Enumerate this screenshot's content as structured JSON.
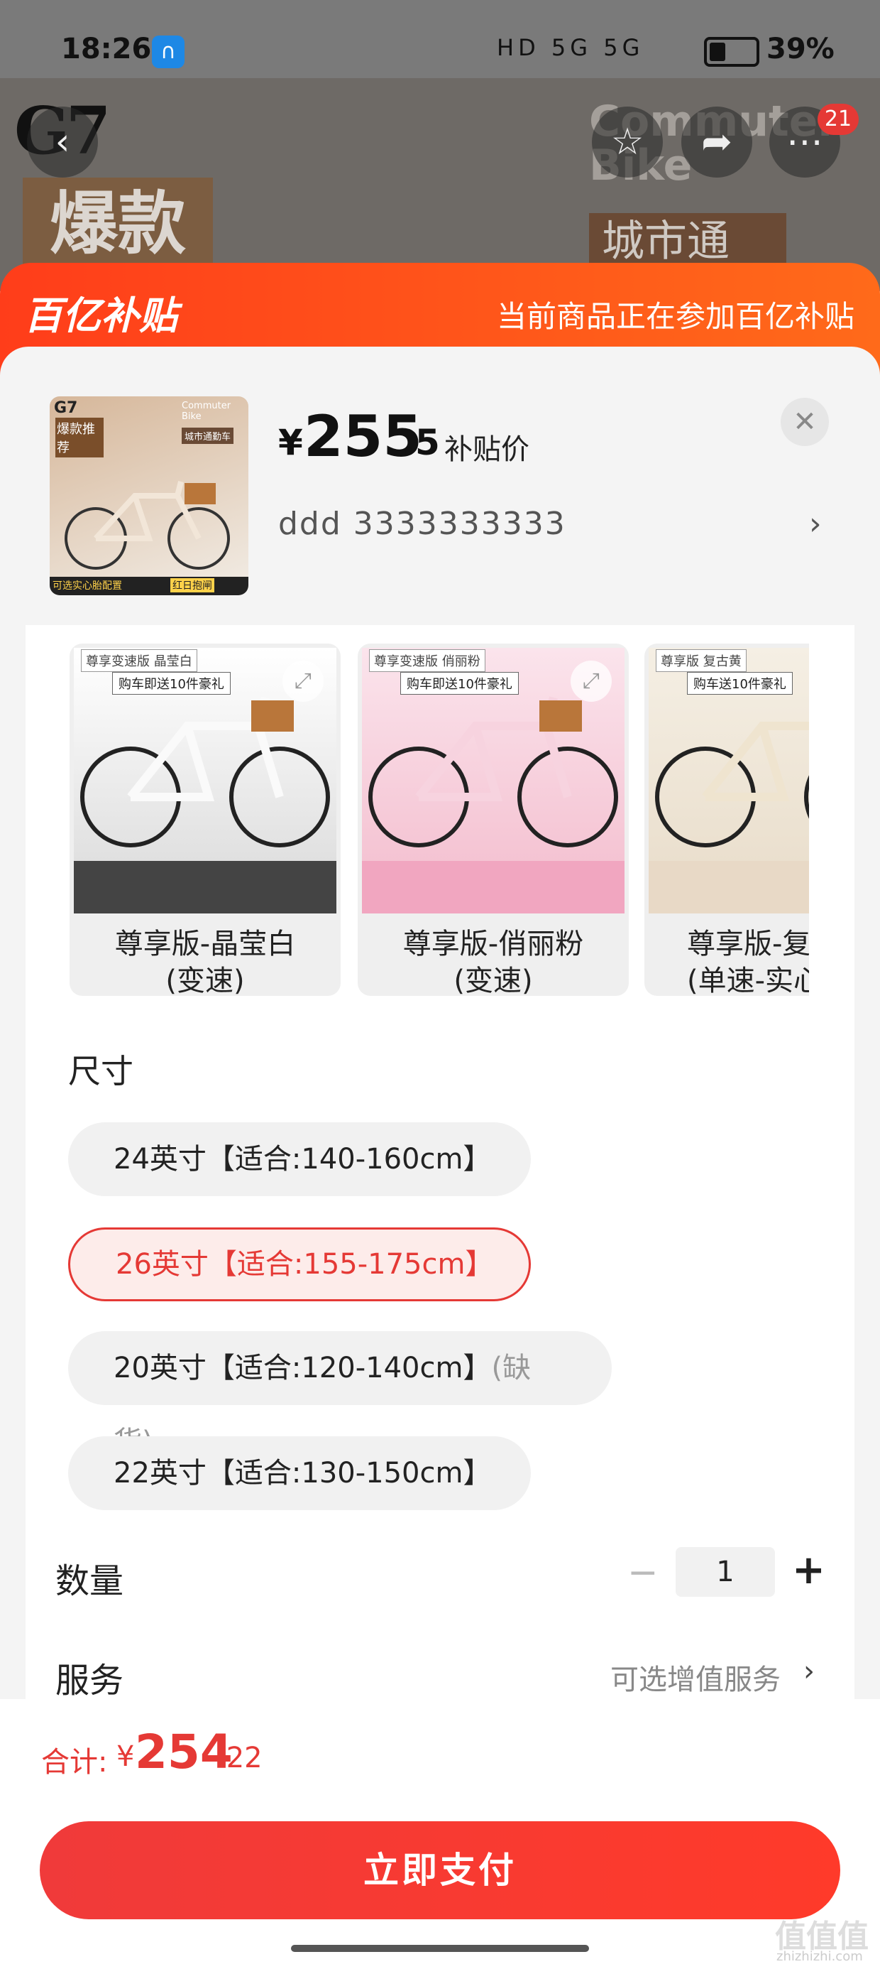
{
  "status_bar": {
    "time": "18:26",
    "battery": "39%",
    "headphones_icon": "headphones-icon",
    "signal_text": "HD 5G 5G"
  },
  "hero": {
    "brand": "G7",
    "hot_label": "爆款",
    "en_title": "Commuter Bike",
    "city_label": "城市通",
    "cart_badge": "21",
    "icons": [
      "back-arrow-icon",
      "star-icon",
      "share-icon",
      "more-icon"
    ]
  },
  "banner": {
    "logo": "百亿补贴",
    "message": "当前商品正在参加百亿补贴"
  },
  "product": {
    "price_symbol": "¥",
    "price_int": "255",
    "price_dec": ".5",
    "price_label": "补贴价",
    "sku_text": "ddd  3333333333",
    "thumb": {
      "brand": "G7",
      "hot": "爆款推荐",
      "en": "Commuter Bike",
      "city": "城市通勤车",
      "footer_left": "可选实心胎配置",
      "footer_right": "红日抱闸"
    }
  },
  "variants": [
    {
      "line1": "尊享版-晶莹白",
      "line2": "(变速)",
      "tag": "尊享变速版 晶莹白",
      "gift": "购车即送10件豪礼",
      "frame": "#ffffff",
      "strip": ""
    },
    {
      "line1": "尊享版-俏丽粉",
      "line2": "(变速)",
      "tag": "尊享变速版 俏丽粉",
      "gift": "购车即送10件豪礼",
      "frame": "#f5c6d6",
      "strip": "pink"
    },
    {
      "line1": "尊享版-复",
      "line2": "(单速-实心",
      "tag": "尊享版 复古黄",
      "gift": "购车送10件豪礼",
      "frame": "#efe6d6",
      "strip": "cream"
    }
  ],
  "size_section": {
    "title": "尺寸"
  },
  "sizes": [
    {
      "label": "24英寸【适合:140-160cm】",
      "oos": "",
      "selected": false
    },
    {
      "label": "26英寸【适合:155-175cm】",
      "oos": "",
      "selected": true
    },
    {
      "label": "20英寸【适合:120-140cm】",
      "oos": "(缺货)",
      "selected": false
    },
    {
      "label": "22英寸【适合:130-150cm】",
      "oos": "",
      "selected": false
    }
  ],
  "quantity": {
    "label": "数量",
    "value": "1",
    "minus": "−",
    "plus": "+"
  },
  "service": {
    "label": "服务",
    "value": "可选增值服务",
    "arrow": "›"
  },
  "total": {
    "label": "合计:",
    "symbol": "¥",
    "int": "254",
    "dec": ".22"
  },
  "pay_button": "立即支付",
  "watermark": {
    "text": "值值值",
    "sub": "zhizhizhi.com"
  },
  "colors": {
    "accent": "#e53935",
    "banner": "#ff4a1a"
  }
}
